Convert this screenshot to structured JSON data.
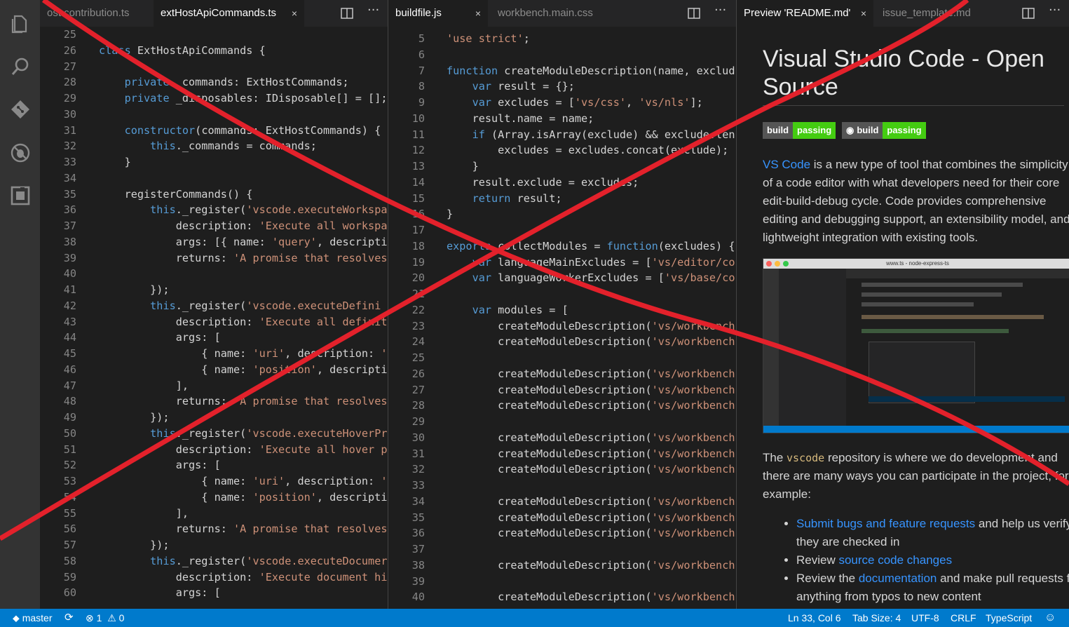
{
  "group1": {
    "tabs": [
      {
        "label": "ost.contribution.ts",
        "active": false
      },
      {
        "label": "extHostApiCommands.ts",
        "active": true,
        "close": "×"
      }
    ],
    "lines": [
      {
        "n": "25",
        "t": ""
      },
      {
        "n": "26",
        "t": "class ExtHostApiCommands {"
      },
      {
        "n": "27",
        "t": ""
      },
      {
        "n": "28",
        "t": "    private _commands: ExtHostCommands;"
      },
      {
        "n": "29",
        "t": "    private _disposables: IDisposable[] = [];"
      },
      {
        "n": "30",
        "t": ""
      },
      {
        "n": "31",
        "t": "    constructor(commands: ExtHostCommands) {"
      },
      {
        "n": "32",
        "t": "        this._commands = commands;"
      },
      {
        "n": "33",
        "t": "    }"
      },
      {
        "n": "34",
        "t": ""
      },
      {
        "n": "35",
        "t": "    registerCommands() {"
      },
      {
        "n": "36",
        "t": "        this._register('vscode.executeWorkspa"
      },
      {
        "n": "37",
        "t": "            description: 'Execute all workspa"
      },
      {
        "n": "38",
        "t": "            args: [{ name: 'query', descripti"
      },
      {
        "n": "39",
        "t": "            returns: 'A promise that resolves"
      },
      {
        "n": "40",
        "t": ""
      },
      {
        "n": "41",
        "t": "        });"
      },
      {
        "n": "42",
        "t": "        this._register('vscode.executeDefini"
      },
      {
        "n": "43",
        "t": "            description: 'Execute all definit"
      },
      {
        "n": "44",
        "t": "            args: ["
      },
      {
        "n": "45",
        "t": "                { name: 'uri', description: '"
      },
      {
        "n": "46",
        "t": "                { name: 'position', descripti"
      },
      {
        "n": "47",
        "t": "            ],"
      },
      {
        "n": "48",
        "t": "            returns: 'A promise that resolves"
      },
      {
        "n": "49",
        "t": "        });"
      },
      {
        "n": "50",
        "t": "        this._register('vscode.executeHoverPr"
      },
      {
        "n": "51",
        "t": "            description: 'Execute all hover p"
      },
      {
        "n": "52",
        "t": "            args: ["
      },
      {
        "n": "53",
        "t": "                { name: 'uri', description: '"
      },
      {
        "n": "54",
        "t": "                { name: 'position', descripti"
      },
      {
        "n": "55",
        "t": "            ],"
      },
      {
        "n": "56",
        "t": "            returns: 'A promise that resolves"
      },
      {
        "n": "57",
        "t": "        });"
      },
      {
        "n": "58",
        "t": "        this._register('vscode.executeDocumer"
      },
      {
        "n": "59",
        "t": "            description: 'Execute document hi"
      },
      {
        "n": "60",
        "t": "            args: ["
      }
    ]
  },
  "group2": {
    "tabs": [
      {
        "label": "buildfile.js",
        "active": true,
        "close": "×"
      },
      {
        "label": "workbench.main.css",
        "active": false
      }
    ],
    "lines": [
      {
        "n": "5",
        "t": "'use strict';"
      },
      {
        "n": "6",
        "t": ""
      },
      {
        "n": "7",
        "t": "function createModuleDescription(name, exclud"
      },
      {
        "n": "8",
        "t": "    var result = {};"
      },
      {
        "n": "9",
        "t": "    var excludes = ['vs/css', 'vs/nls'];"
      },
      {
        "n": "10",
        "t": "    result.name = name;"
      },
      {
        "n": "11",
        "t": "    if (Array.isArray(exclude) && exclude.len"
      },
      {
        "n": "12",
        "t": "        excludes = excludes.concat(exclude);"
      },
      {
        "n": "13",
        "t": "    }"
      },
      {
        "n": "14",
        "t": "    result.exclude = excludes;"
      },
      {
        "n": "15",
        "t": "    return result;"
      },
      {
        "n": "16",
        "t": "}"
      },
      {
        "n": "17",
        "t": ""
      },
      {
        "n": "18",
        "t": "exports.collectModules = function(excludes) {"
      },
      {
        "n": "19",
        "t": "    var languageMainExcludes = ['vs/editor/co"
      },
      {
        "n": "20",
        "t": "    var languageWorkerExcludes = ['vs/base/co"
      },
      {
        "n": "21",
        "t": ""
      },
      {
        "n": "22",
        "t": "    var modules = ["
      },
      {
        "n": "23",
        "t": "        createModuleDescription('vs/workbench"
      },
      {
        "n": "24",
        "t": "        createModuleDescription('vs/workbench"
      },
      {
        "n": "25",
        "t": ""
      },
      {
        "n": "26",
        "t": "        createModuleDescription('vs/workbench"
      },
      {
        "n": "27",
        "t": "        createModuleDescription('vs/workbench"
      },
      {
        "n": "28",
        "t": "        createModuleDescription('vs/workbench"
      },
      {
        "n": "29",
        "t": ""
      },
      {
        "n": "30",
        "t": "        createModuleDescription('vs/workbench"
      },
      {
        "n": "31",
        "t": "        createModuleDescription('vs/workbench"
      },
      {
        "n": "32",
        "t": "        createModuleDescription('vs/workbench"
      },
      {
        "n": "33",
        "t": ""
      },
      {
        "n": "34",
        "t": "        createModuleDescription('vs/workbench"
      },
      {
        "n": "35",
        "t": "        createModuleDescription('vs/workbench"
      },
      {
        "n": "36",
        "t": "        createModuleDescription('vs/workbench"
      },
      {
        "n": "37",
        "t": ""
      },
      {
        "n": "38",
        "t": "        createModuleDescription('vs/workbench"
      },
      {
        "n": "39",
        "t": ""
      },
      {
        "n": "40",
        "t": "        createModuleDescription('vs/workbench"
      }
    ]
  },
  "group3": {
    "tabs": [
      {
        "label": "Preview 'README.md'",
        "active": true,
        "close": "×"
      },
      {
        "label": "issue_template.md",
        "active": false
      }
    ]
  },
  "preview": {
    "title": "Visual Studio Code - Open Source",
    "badge1": {
      "left": "build",
      "right": "passing"
    },
    "badge2": {
      "left": "build",
      "right": "passing"
    },
    "intro_link": "VS Code",
    "intro_text": " is a new type of tool that combines the simplicity of a code editor with what developers need for their core edit-build-debug cycle. Code provides comprehensive editing and debugging support, an extensibility model, and lightweight integration with existing tools.",
    "repo_pre": "The ",
    "repo_code": "vscode",
    "repo_post": " repository is where we do development and there are many ways you can participate in the project, for example:",
    "bullets": [
      {
        "link": "Submit bugs and feature requests",
        "pre": "",
        "post": " and help us verify as they are checked in"
      },
      {
        "pre": "Review ",
        "link": "source code changes",
        "post": ""
      },
      {
        "pre": "Review the ",
        "link": "documentation",
        "post": " and make pull requests for anything from typos to new content"
      }
    ],
    "screenshot_title": "www.ts - node-express-ts"
  },
  "status": {
    "branch": "master",
    "errors": "1",
    "warnings": "0",
    "position": "Ln 33, Col 6",
    "tab_size": "Tab Size: 4",
    "encoding": "UTF-8",
    "eol": "CRLF",
    "language": "TypeScript"
  },
  "colors": {
    "accent": "#007acc",
    "cross": "#e3212b"
  }
}
